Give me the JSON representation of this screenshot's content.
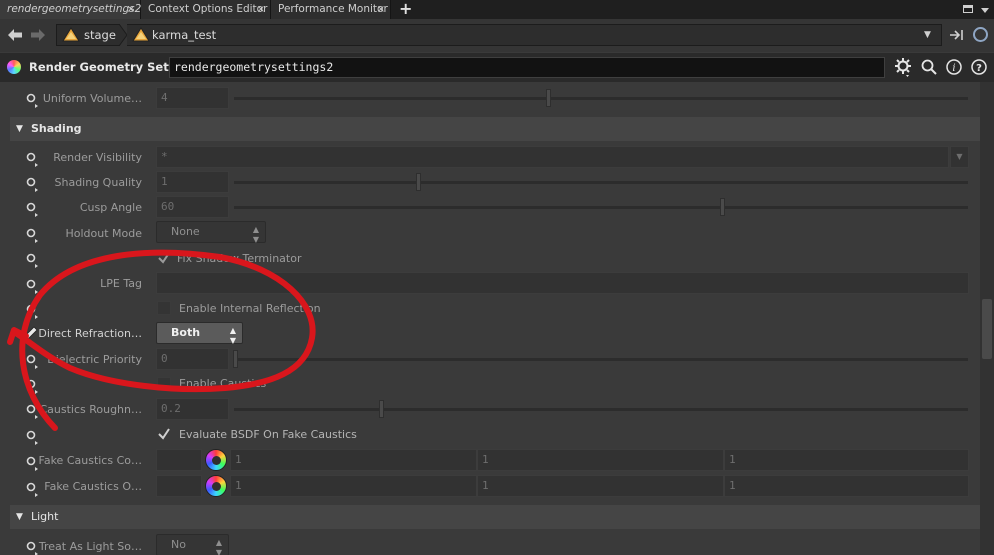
{
  "tabs": [
    {
      "label": "rendergeometrysettings2",
      "close": "×"
    },
    {
      "label": "Context Options Editor",
      "close": "×"
    },
    {
      "label": "Performance Monitor",
      "close": "×"
    }
  ],
  "new_tab_symbol": "+",
  "path": {
    "stage": "stage",
    "node": "karma_test"
  },
  "node_header": {
    "type_label": "Render Geometry Settings",
    "name": "rendergeometrysettings2"
  },
  "params": {
    "uniform_volume": {
      "label": "Uniform Volume…",
      "value": "4"
    },
    "shading_section": "Shading",
    "render_visibility": {
      "label": "Render Visibility",
      "value": "*"
    },
    "shading_quality": {
      "label": "Shading Quality",
      "value": "1"
    },
    "cusp_angle": {
      "label": "Cusp Angle",
      "value": "60"
    },
    "holdout_mode": {
      "label": "Holdout Mode",
      "value": "None"
    },
    "fix_shadow_terminator": {
      "label": "Fix Shadow Terminator"
    },
    "lpe_tag": {
      "label": "LPE Tag",
      "value": ""
    },
    "enable_internal_reflection": {
      "label": "Enable Internal Reflection"
    },
    "direct_refraction": {
      "label": "Direct Refraction…",
      "value": "Both"
    },
    "dielectric_priority": {
      "label": "Dielectric Priority",
      "value": "0"
    },
    "enable_caustics": {
      "label": "Enable Caustics"
    },
    "caustics_roughness": {
      "label": "Caustics Roughn…",
      "value": "0.2"
    },
    "evaluate_bsdf": {
      "label": "Evaluate BSDF On Fake Caustics"
    },
    "fake_caustics_color": {
      "label": "Fake Caustics Co…",
      "values": [
        "1",
        "1",
        "1"
      ]
    },
    "fake_caustics_opacity": {
      "label": "Fake Caustics O…",
      "values": [
        "1",
        "1",
        "1"
      ]
    },
    "light_section": "Light",
    "treat_as_light_source": {
      "label": "Treat As Light So…",
      "value": "No"
    }
  },
  "colors": {
    "annotation_red": "#d9161c",
    "accent": "#cfa13a"
  }
}
